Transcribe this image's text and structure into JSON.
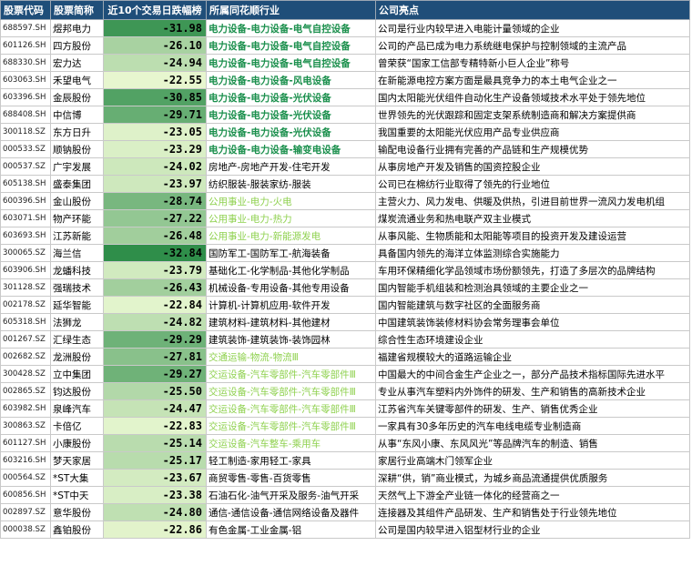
{
  "headers": [
    "股票代码",
    "股票简称",
    "近10个交易日跌幅榜",
    "所属同花顺行业",
    "公司亮点"
  ],
  "colors": {
    "header_bg": "#1f4e79",
    "industry_dark_green": "#1a8f4c",
    "industry_light_green": "#8fd14f"
  },
  "rows": [
    {
      "code": "688597.SH",
      "name": "煜邦电力",
      "change": "-31.98",
      "industry": "电力设备-电力设备-电气自控设备",
      "note": "公司是行业内较早进入电能计量领域的企业"
    },
    {
      "code": "601126.SH",
      "name": "四方股份",
      "change": "-26.10",
      "industry": "电力设备-电力设备-电气自控设备",
      "note": "公司的产品已成为电力系统继电保护与控制领域的主流产品"
    },
    {
      "code": "688330.SH",
      "name": "宏力达",
      "change": "-24.94",
      "industry": "电力设备-电力设备-电气自控设备",
      "note": "曾荣获“国家工信部专精特新小巨人企业”称号"
    },
    {
      "code": "603063.SH",
      "name": "禾望电气",
      "change": "-22.55",
      "industry": "电力设备-电力设备-风电设备",
      "note": "在新能源电控方案方面是最具竞争力的本土电气企业之一"
    },
    {
      "code": "603396.SH",
      "name": "金辰股份",
      "change": "-30.85",
      "industry": "电力设备-电力设备-光伏设备",
      "note": "国内太阳能光伏组件自动化生产设备领域技术水平处于领先地位"
    },
    {
      "code": "688408.SH",
      "name": "中信博",
      "change": "-29.71",
      "industry": "电力设备-电力设备-光伏设备",
      "note": "世界领先的光伏跟踪和固定支架系统制造商和解决方案提供商"
    },
    {
      "code": "300118.SZ",
      "name": "东方日升",
      "change": "-23.05",
      "industry": "电力设备-电力设备-光伏设备",
      "note": "我国重要的太阳能光伏应用产品专业供应商"
    },
    {
      "code": "000533.SZ",
      "name": "顺钠股份",
      "change": "-23.29",
      "industry": "电力设备-电力设备-输变电设备",
      "note": "输配电设备行业拥有完善的产品链和生产规模优势"
    },
    {
      "code": "000537.SZ",
      "name": "广宇发展",
      "change": "-24.02",
      "industry": "房地产-房地产开发-住宅开发",
      "note": "从事房地产开发及销售的国资控股企业"
    },
    {
      "code": "605138.SH",
      "name": "盛泰集团",
      "change": "-23.97",
      "industry": "纺织服装-服装家纺-服装",
      "note": "公司已在棉纺行业取得了领先的行业地位"
    },
    {
      "code": "600396.SH",
      "name": "金山股份",
      "change": "-28.74",
      "industry": "公用事业-电力-火电",
      "note": "主营火力、风力发电、供暖及供热，引进目前世界一流风力发电机组"
    },
    {
      "code": "603071.SH",
      "name": "物产环能",
      "change": "-27.22",
      "industry": "公用事业-电力-热力",
      "note": "煤炭流通业务和热电联产双主业模式"
    },
    {
      "code": "603693.SH",
      "name": "江苏新能",
      "change": "-26.48",
      "industry": "公用事业-电力-新能源发电",
      "note": "从事风能、生物质能和太阳能等项目的投资开发及建设运营"
    },
    {
      "code": "300065.SZ",
      "name": "海兰信",
      "change": "-32.84",
      "industry": "国防军工-国防军工-航海装备",
      "note": "具备国内领先的海洋立体监测综合实施能力"
    },
    {
      "code": "603906.SH",
      "name": "龙蟠科技",
      "change": "-23.79",
      "industry": "基础化工-化学制品-其他化学制品",
      "note": "车用环保精细化学品领域市场份额领先，打造了多层次的品牌结构"
    },
    {
      "code": "301128.SZ",
      "name": "强瑞技术",
      "change": "-26.43",
      "industry": "机械设备-专用设备-其他专用设备",
      "note": "国内智能手机组装和检测治具领域的主要企业之一"
    },
    {
      "code": "002178.SZ",
      "name": "延华智能",
      "change": "-22.84",
      "industry": "计算机-计算机应用-软件开发",
      "note": "国内智能建筑与数字社区的全面服务商"
    },
    {
      "code": "605318.SH",
      "name": "法狮龙",
      "change": "-24.82",
      "industry": "建筑材料-建筑材料-其他建材",
      "note": "中国建筑装饰装修材料协会常务理事会单位"
    },
    {
      "code": "001267.SZ",
      "name": "汇绿生态",
      "change": "-29.29",
      "industry": "建筑装饰-建筑装饰-装饰园林",
      "note": "综合性生态环境建设企业"
    },
    {
      "code": "002682.SZ",
      "name": "龙洲股份",
      "change": "-27.81",
      "industry": "交通运输-物流-物流Ⅲ",
      "note": "福建省规模较大的道路运输企业"
    },
    {
      "code": "300428.SZ",
      "name": "立中集团",
      "change": "-29.27",
      "industry": "交运设备-汽车零部件-汽车零部件Ⅲ",
      "note": "中国最大的中间合金生产企业之一，部分产品技术指标国际先进水平"
    },
    {
      "code": "002865.SZ",
      "name": "钧达股份",
      "change": "-25.50",
      "industry": "交运设备-汽车零部件-汽车零部件Ⅲ",
      "note": "专业从事汽车塑料内外饰件的研发、生产和销售的高新技术企业"
    },
    {
      "code": "603982.SH",
      "name": "泉峰汽车",
      "change": "-24.47",
      "industry": "交运设备-汽车零部件-汽车零部件Ⅲ",
      "note": "江苏省汽车关键零部件的研发、生产、销售优秀企业"
    },
    {
      "code": "300863.SZ",
      "name": "卡倍亿",
      "change": "-22.83",
      "industry": "交运设备-汽车零部件-汽车零部件Ⅲ",
      "note": "一家具有30多年历史的汽车电线电缆专业制造商"
    },
    {
      "code": "601127.SH",
      "name": "小康股份",
      "change": "-25.14",
      "industry": "交运设备-汽车整车-乘用车",
      "note": "从事“东风小康、东风风光”等品牌汽车的制造、销售"
    },
    {
      "code": "603216.SH",
      "name": "梦天家居",
      "change": "-25.17",
      "industry": "轻工制造-家用轻工-家具",
      "note": "家居行业高端木门领军企业"
    },
    {
      "code": "000564.SZ",
      "name": "*ST大集",
      "change": "-23.67",
      "industry": "商贸零售-零售-百货零售",
      "note": "深耕“供，销”商业模式，为城乡商品流通提供优质服务"
    },
    {
      "code": "600856.SH",
      "name": "*ST中天",
      "change": "-23.38",
      "industry": "石油石化-油气开采及服务-油气开采",
      "note": "天然气上下游全产业链一体化的经营商之一"
    },
    {
      "code": "002897.SZ",
      "name": "意华股份",
      "change": "-24.80",
      "industry": "通信-通信设备-通信网络设备及器件",
      "note": "连接器及其组件产品研发、生产和销售处于行业领先地位"
    },
    {
      "code": "000038.SZ",
      "name": "鑫铂股份",
      "change": "-22.86",
      "industry": "有色金属-工业金属-铝",
      "note": "公司是国内较早进入铝型材行业的企业"
    }
  ]
}
